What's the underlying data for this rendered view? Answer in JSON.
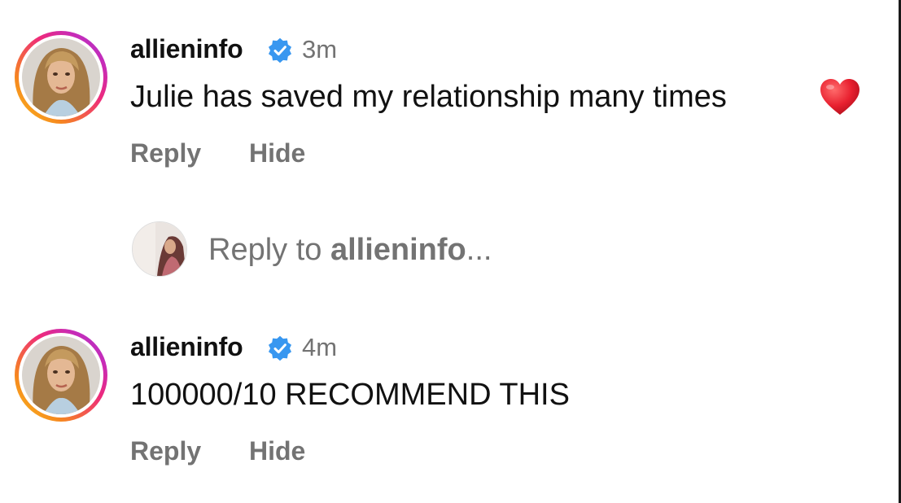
{
  "comments": [
    {
      "username": "allieninfo",
      "verified": true,
      "time": "3m",
      "text": "Julie has saved my relationship many times",
      "emoji": "red-heart-icon",
      "reply_label": "Reply",
      "hide_label": "Hide"
    },
    {
      "username": "allieninfo",
      "verified": true,
      "time": "4m",
      "text": "100000/10 RECOMMEND THIS",
      "reply_label": "Reply",
      "hide_label": "Hide"
    }
  ],
  "reply_box": {
    "prefix": "Reply to ",
    "target": "allieninfo",
    "suffix": "..."
  },
  "colors": {
    "text": "#111111",
    "secondary": "#737373",
    "verified": "#3897f0",
    "heart": "#e8202f"
  }
}
